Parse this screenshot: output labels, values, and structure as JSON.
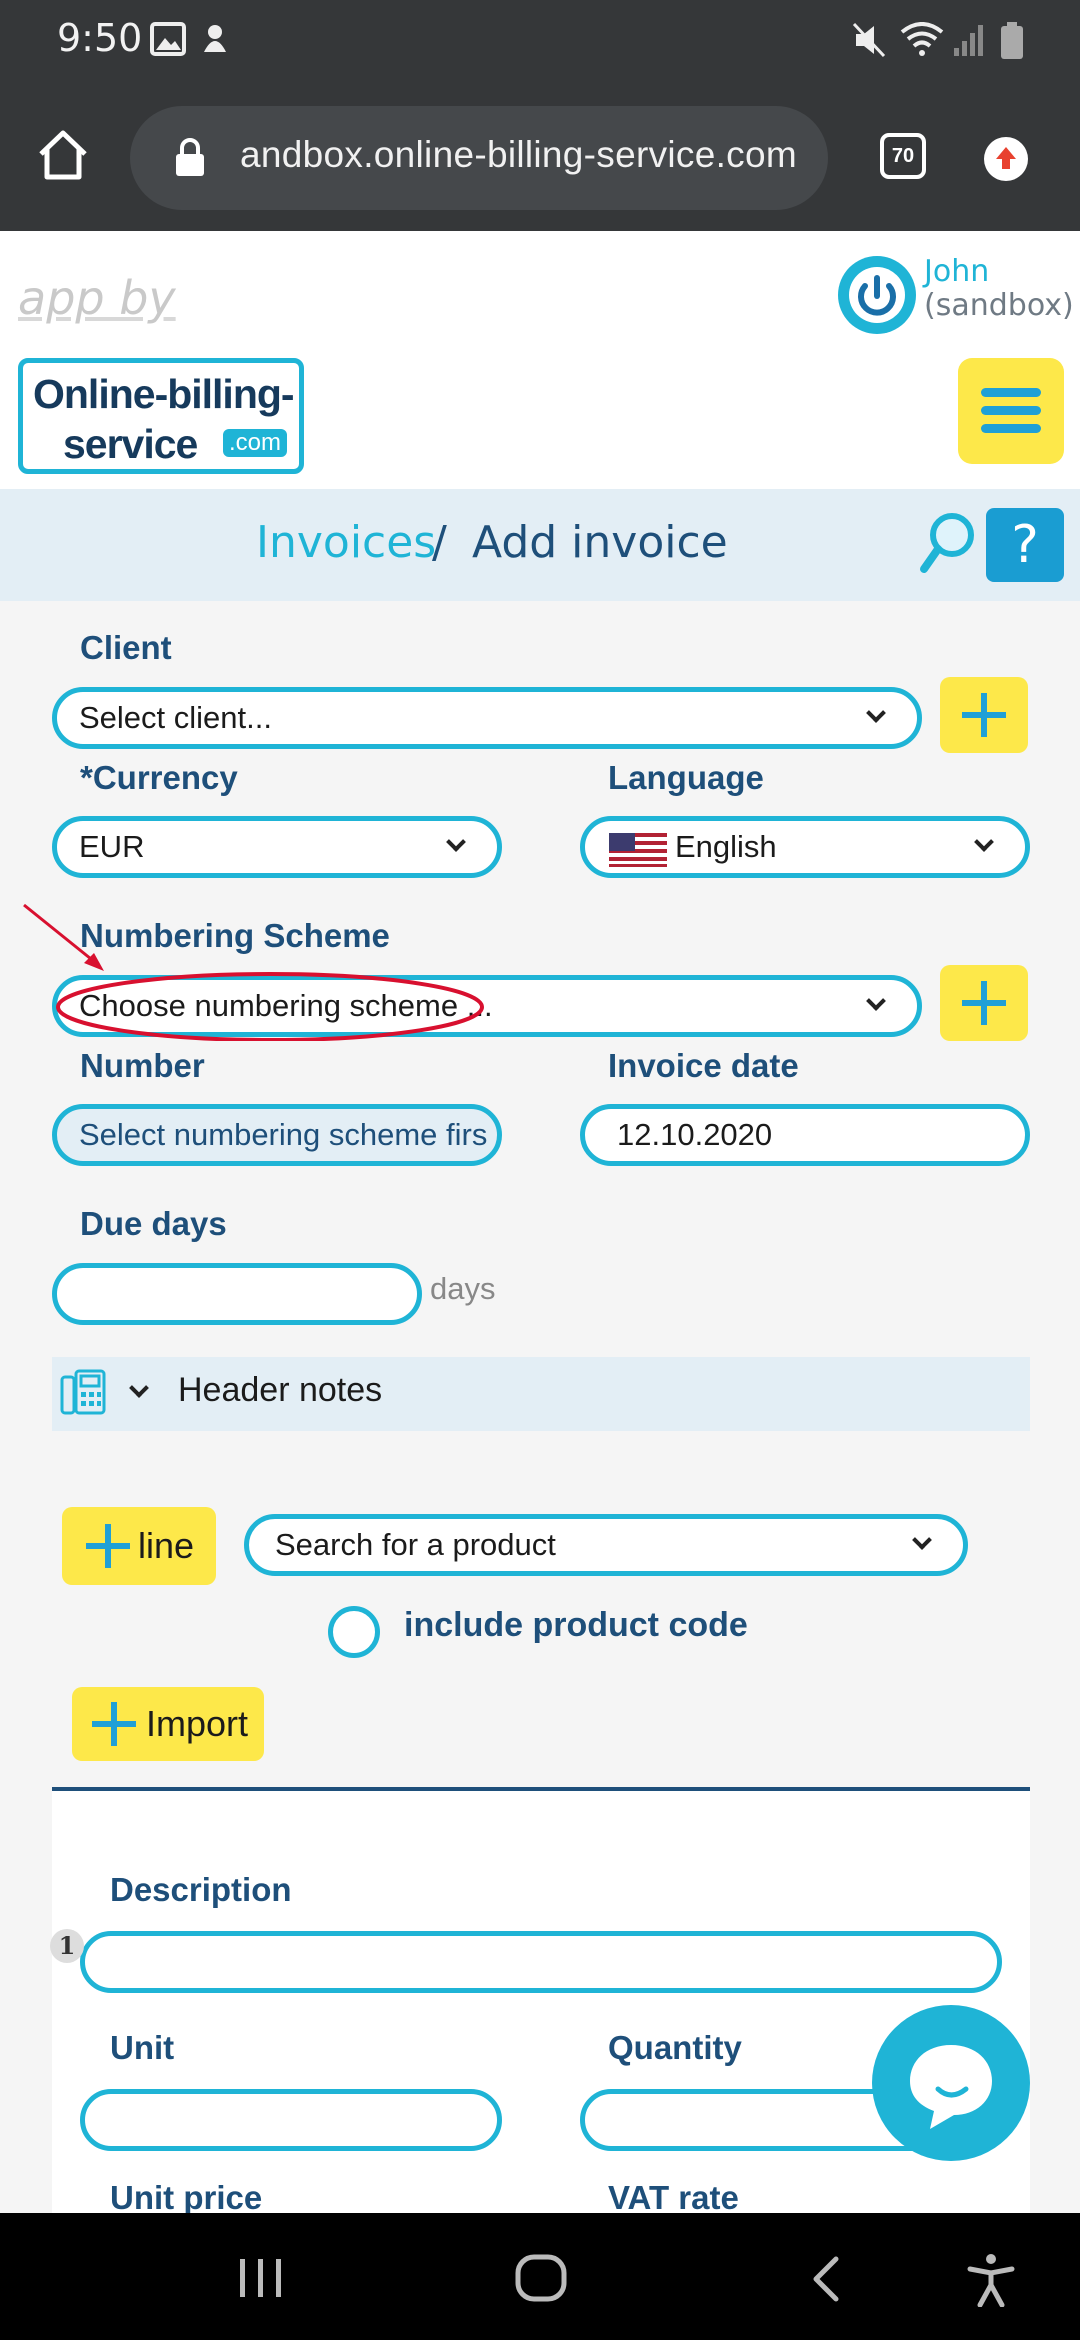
{
  "status_bar": {
    "time": "9:50",
    "icons": [
      "gallery-icon",
      "notification-icon",
      "mute-icon",
      "wifi-icon",
      "signal-icon",
      "battery-icon"
    ]
  },
  "browser": {
    "url": "andbox.online-billing-service.com",
    "tab_count": "70",
    "icons": [
      "home-icon",
      "lock-icon",
      "upload-icon"
    ]
  },
  "header": {
    "app_by": "app by",
    "logo_line1": "Online-billing-",
    "logo_line2": "service",
    "logo_dotcom": ".com",
    "user_name": "John",
    "user_sub": "(sandbox)"
  },
  "breadcrumb": {
    "parent": "Invoices",
    "separator": "/",
    "current": "Add invoice",
    "help": "?"
  },
  "form": {
    "client_label": "Client",
    "client_value": "Select client...",
    "currency_required": "*",
    "currency_label": "Currency",
    "currency_value": "EUR",
    "language_label": "Language",
    "language_value": "English",
    "numbering_label": "Numbering Scheme",
    "numbering_value": "Choose numbering scheme ...",
    "number_label": "Number",
    "number_value": "Select numbering scheme firs",
    "invoice_date_label": "Invoice date",
    "invoice_date_value": "12.10.2020",
    "due_days_label": "Due days",
    "due_days_value": "",
    "days_suffix": "days",
    "header_notes": "Header notes",
    "add_line": "line",
    "product_search": "Search for a product",
    "include_code": "include product code",
    "import": "Import",
    "line_number": "1",
    "description_label": "Description",
    "unit_label": "Unit",
    "quantity_label": "Quantity",
    "unit_price_label": "Unit price",
    "vat_rate_label": "VAT rate"
  },
  "colors": {
    "accent": "#1fb4d6",
    "navy": "#1e4f7a",
    "yellow": "#fde84a",
    "annotation_red": "#d8102f"
  }
}
